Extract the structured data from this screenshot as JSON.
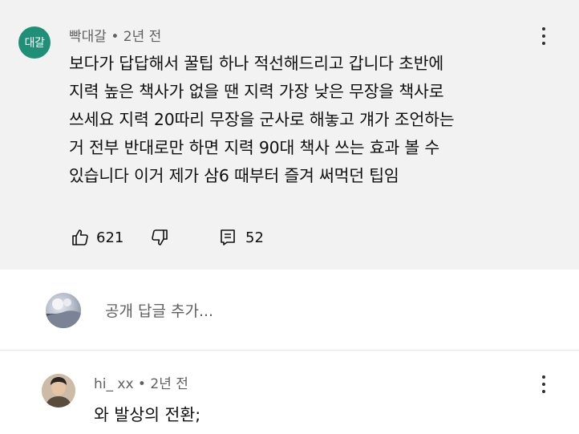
{
  "comment": {
    "avatar_text": "대갈",
    "author": "빡대갈",
    "separator": " • ",
    "time": "2년 전",
    "lines": [
      "보다가 답답해서 꿀팁 하나 적선해드리고 갑니다 초반에",
      "지력 높은 책사가 없을 땐 지력 가장 낮은 무장을 책사로",
      "쓰세요 지력 20따리 무장을 군사로 해놓고 걔가 조언하는",
      "거 전부 반대로만 하면 지력 90대 책사 쓰는 효과 볼 수",
      "있습니다 이거 제가 삼6 때부터 즐겨 써먹던 팁임"
    ],
    "like_count": "621",
    "reply_count": "52"
  },
  "reply_box": {
    "placeholder": "공개 답글 추가..."
  },
  "reply": {
    "author": "hi_ xx",
    "separator": " • ",
    "time": "2년 전",
    "text": "와 발상의 전환;"
  },
  "icons": {
    "comment_menu": "more-vertical-icon",
    "like": "thumb-up-icon",
    "dislike": "thumb-down-icon",
    "replies": "comment-icon",
    "reply_menu": "more-vertical-icon"
  },
  "colors": {
    "comment_background": "#f2f2f2",
    "avatar_badge": "#1f8f78",
    "meta_text": "#606060",
    "body_text": "#0f0f0f"
  }
}
